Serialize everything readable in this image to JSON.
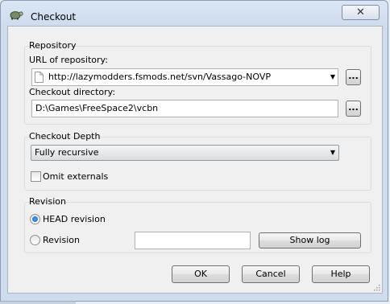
{
  "window": {
    "title": "Checkout",
    "close_glyph": "✕"
  },
  "repository": {
    "group_label": "Repository",
    "url_label": "URL of repository:",
    "url_value": "http://lazymodders.fsmods.net/svn/Vassago-NOVP",
    "checkout_dir_label": "Checkout directory:",
    "checkout_dir_value": "D:\\Games\\FreeSpace2\\vcbn",
    "browse_label": "..."
  },
  "depth": {
    "group_label": "Checkout Depth",
    "selected": "Fully recursive",
    "omit_externals_label": "Omit externals",
    "omit_externals_checked": false
  },
  "revision": {
    "group_label": "Revision",
    "head_label": "HEAD revision",
    "head_checked": true,
    "revision_label": "Revision",
    "revision_value": "",
    "show_log_label": "Show log"
  },
  "buttons": {
    "ok": "OK",
    "cancel": "Cancel",
    "help": "Help"
  },
  "icons": {
    "title": "tortoise-icon",
    "url": "file-icon",
    "dropdown": "chevron-down-icon"
  },
  "colors": {
    "accent": "#1a5fb4",
    "titlebar": "#dbe6f4"
  }
}
